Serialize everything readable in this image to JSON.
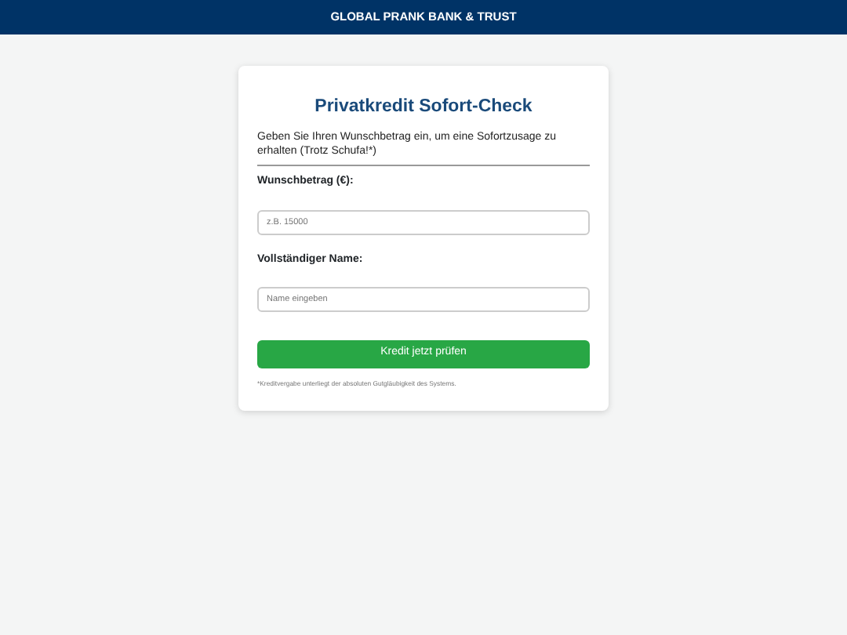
{
  "header": {
    "title": "GLOBAL PRANK BANK & TRUST"
  },
  "form": {
    "title": "Privatkredit Sofort-Check",
    "intro": "Geben Sie Ihren Wunschbetrag ein, um eine Sofortzusage zu erhalten (Trotz Schufa!*)",
    "fields": [
      {
        "label": "Wunschbetrag (€):",
        "placeholder": "z.B. 15000"
      },
      {
        "label": "Vollständiger Name:",
        "placeholder": "Name eingeben"
      }
    ],
    "submit": "Kredit jetzt prüfen",
    "footnote": "*Kreditvergabe unterliegt der absoluten Gutgläubigkeit des Systems."
  }
}
